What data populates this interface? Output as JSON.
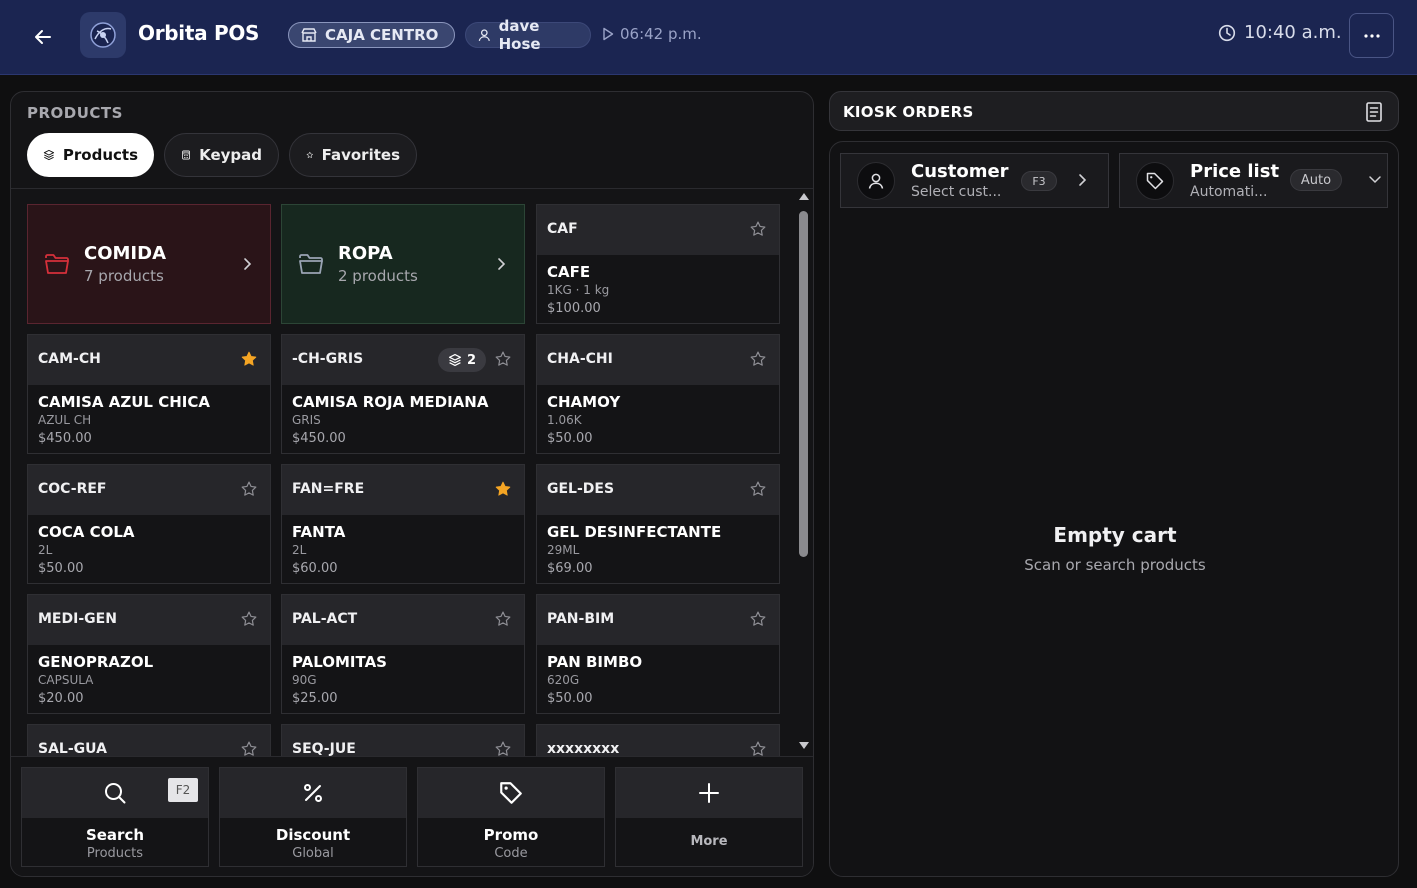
{
  "header": {
    "app_title": "Orbita POS",
    "register": "CAJA CENTRO",
    "user": "dave Hose",
    "session_time": "06:42 p.m.",
    "clock": "10:40 a.m."
  },
  "products_panel": {
    "title": "PRODUCTS",
    "tabs": [
      {
        "label": "Products",
        "icon": "layers-icon",
        "active": true
      },
      {
        "label": "Keypad",
        "icon": "calculator-icon",
        "active": false
      },
      {
        "label": "Favorites",
        "icon": "star-icon",
        "active": false
      }
    ],
    "folders": [
      {
        "name": "COMIDA",
        "count": "7 products",
        "color": "#d6303a"
      },
      {
        "name": "ROPA",
        "count": "2 products",
        "color": "#9aa4b4"
      }
    ],
    "cards": [
      {
        "sku": "CAF",
        "name": "CAFE",
        "sub": "1KG · 1 kg",
        "price": "$100.00",
        "favorite": false
      },
      {
        "sku": "CAM-CH",
        "name": "CAMISA AZUL CHICA",
        "sub": "AZUL CH",
        "price": "$450.00",
        "favorite": true
      },
      {
        "sku": "-CH-GRIS",
        "name": "CAMISA ROJA MEDIANA",
        "sub": "GRIS",
        "price": "$450.00",
        "favorite": false,
        "variants": "2"
      },
      {
        "sku": "CHA-CHI",
        "name": "CHAMOY",
        "sub": "1.06K",
        "price": "$50.00",
        "favorite": false
      },
      {
        "sku": "COC-REF",
        "name": "COCA COLA",
        "sub": "2L",
        "price": "$50.00",
        "favorite": false
      },
      {
        "sku": "FAN=FRE",
        "name": "FANTA",
        "sub": "2L",
        "price": "$60.00",
        "favorite": true
      },
      {
        "sku": "GEL-DES",
        "name": "GEL DESINFECTANTE",
        "sub": "29ML",
        "price": "$69.00",
        "favorite": false
      },
      {
        "sku": "MEDI-GEN",
        "name": "GENOPRAZOL",
        "sub": "CAPSULA",
        "price": "$20.00",
        "favorite": false
      },
      {
        "sku": "PAL-ACT",
        "name": "PALOMITAS",
        "sub": "90G",
        "price": "$25.00",
        "favorite": false
      },
      {
        "sku": "PAN-BIM",
        "name": "PAN BIMBO",
        "sub": "620G",
        "price": "$50.00",
        "favorite": false
      },
      {
        "sku": "SAL-GUA",
        "name": "",
        "sub": "",
        "price": "",
        "favorite": false
      },
      {
        "sku": "SEQ-JUE",
        "name": "",
        "sub": "",
        "price": "",
        "favorite": false
      },
      {
        "sku": "xxxxxxxx",
        "name": "",
        "sub": "",
        "price": "",
        "favorite": false
      }
    ],
    "actions": [
      {
        "label": "Search",
        "sub": "Products",
        "icon": "search-icon",
        "shortcut": "F2"
      },
      {
        "label": "Discount",
        "sub": "Global",
        "icon": "percent-icon"
      },
      {
        "label": "Promo",
        "sub": "Code",
        "icon": "tag-icon"
      },
      {
        "label": "",
        "sub": "More",
        "icon": "plus-icon"
      }
    ]
  },
  "kiosk": {
    "title": "KIOSK ORDERS",
    "customer": {
      "label": "Customer",
      "value": "Select cust...",
      "shortcut": "F3"
    },
    "price_list": {
      "label": "Price list",
      "value": "Automati...",
      "badge": "Auto"
    },
    "cart_empty_title": "Empty cart",
    "cart_empty_sub": "Scan or search products"
  },
  "colors": {
    "header_bg": "#1b2551",
    "favorite_star": "#f5a524",
    "folder_red": "#d6303a"
  }
}
